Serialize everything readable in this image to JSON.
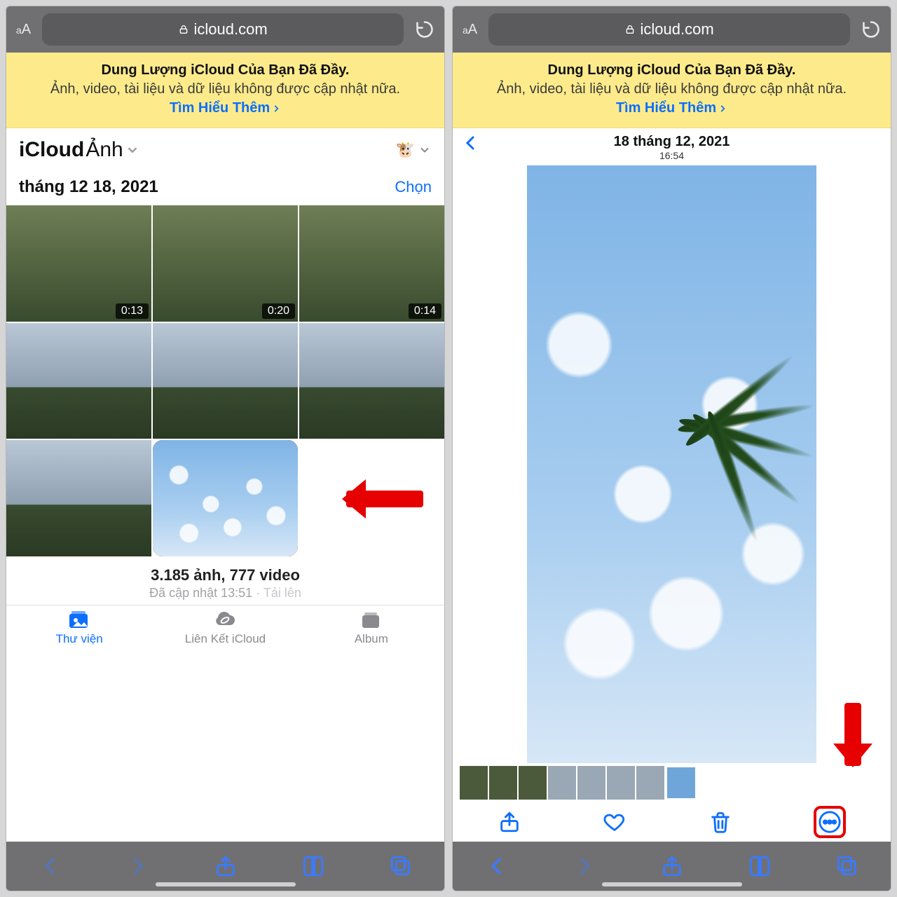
{
  "safari": {
    "aa": "aA",
    "domain": "icloud.com"
  },
  "banner": {
    "title": "Dung Lượng iCloud Của Bạn Đã Đầy.",
    "sub": "Ảnh, video, tài liệu và dữ liệu không được cập nhật nữa.",
    "link": "Tìm Hiểu Thêm"
  },
  "left": {
    "titleA": "iCloud",
    "titleB": "Ảnh",
    "avatar_glyph": "🐮",
    "date": "tháng 12 18, 2021",
    "select": "Chọn",
    "videos": [
      {
        "len": "0:13"
      },
      {
        "len": "0:20"
      },
      {
        "len": "0:14"
      }
    ],
    "counts": {
      "line": "3.185 ảnh, 777 video",
      "updated": "Đã cập nhật 13:51",
      "uploading": "Tải lên"
    },
    "tabs": {
      "library": "Thư viện",
      "links": "Liên Kết iCloud",
      "album": "Album"
    }
  },
  "right": {
    "date": "18 tháng 12, 2021",
    "time": "16:54"
  }
}
